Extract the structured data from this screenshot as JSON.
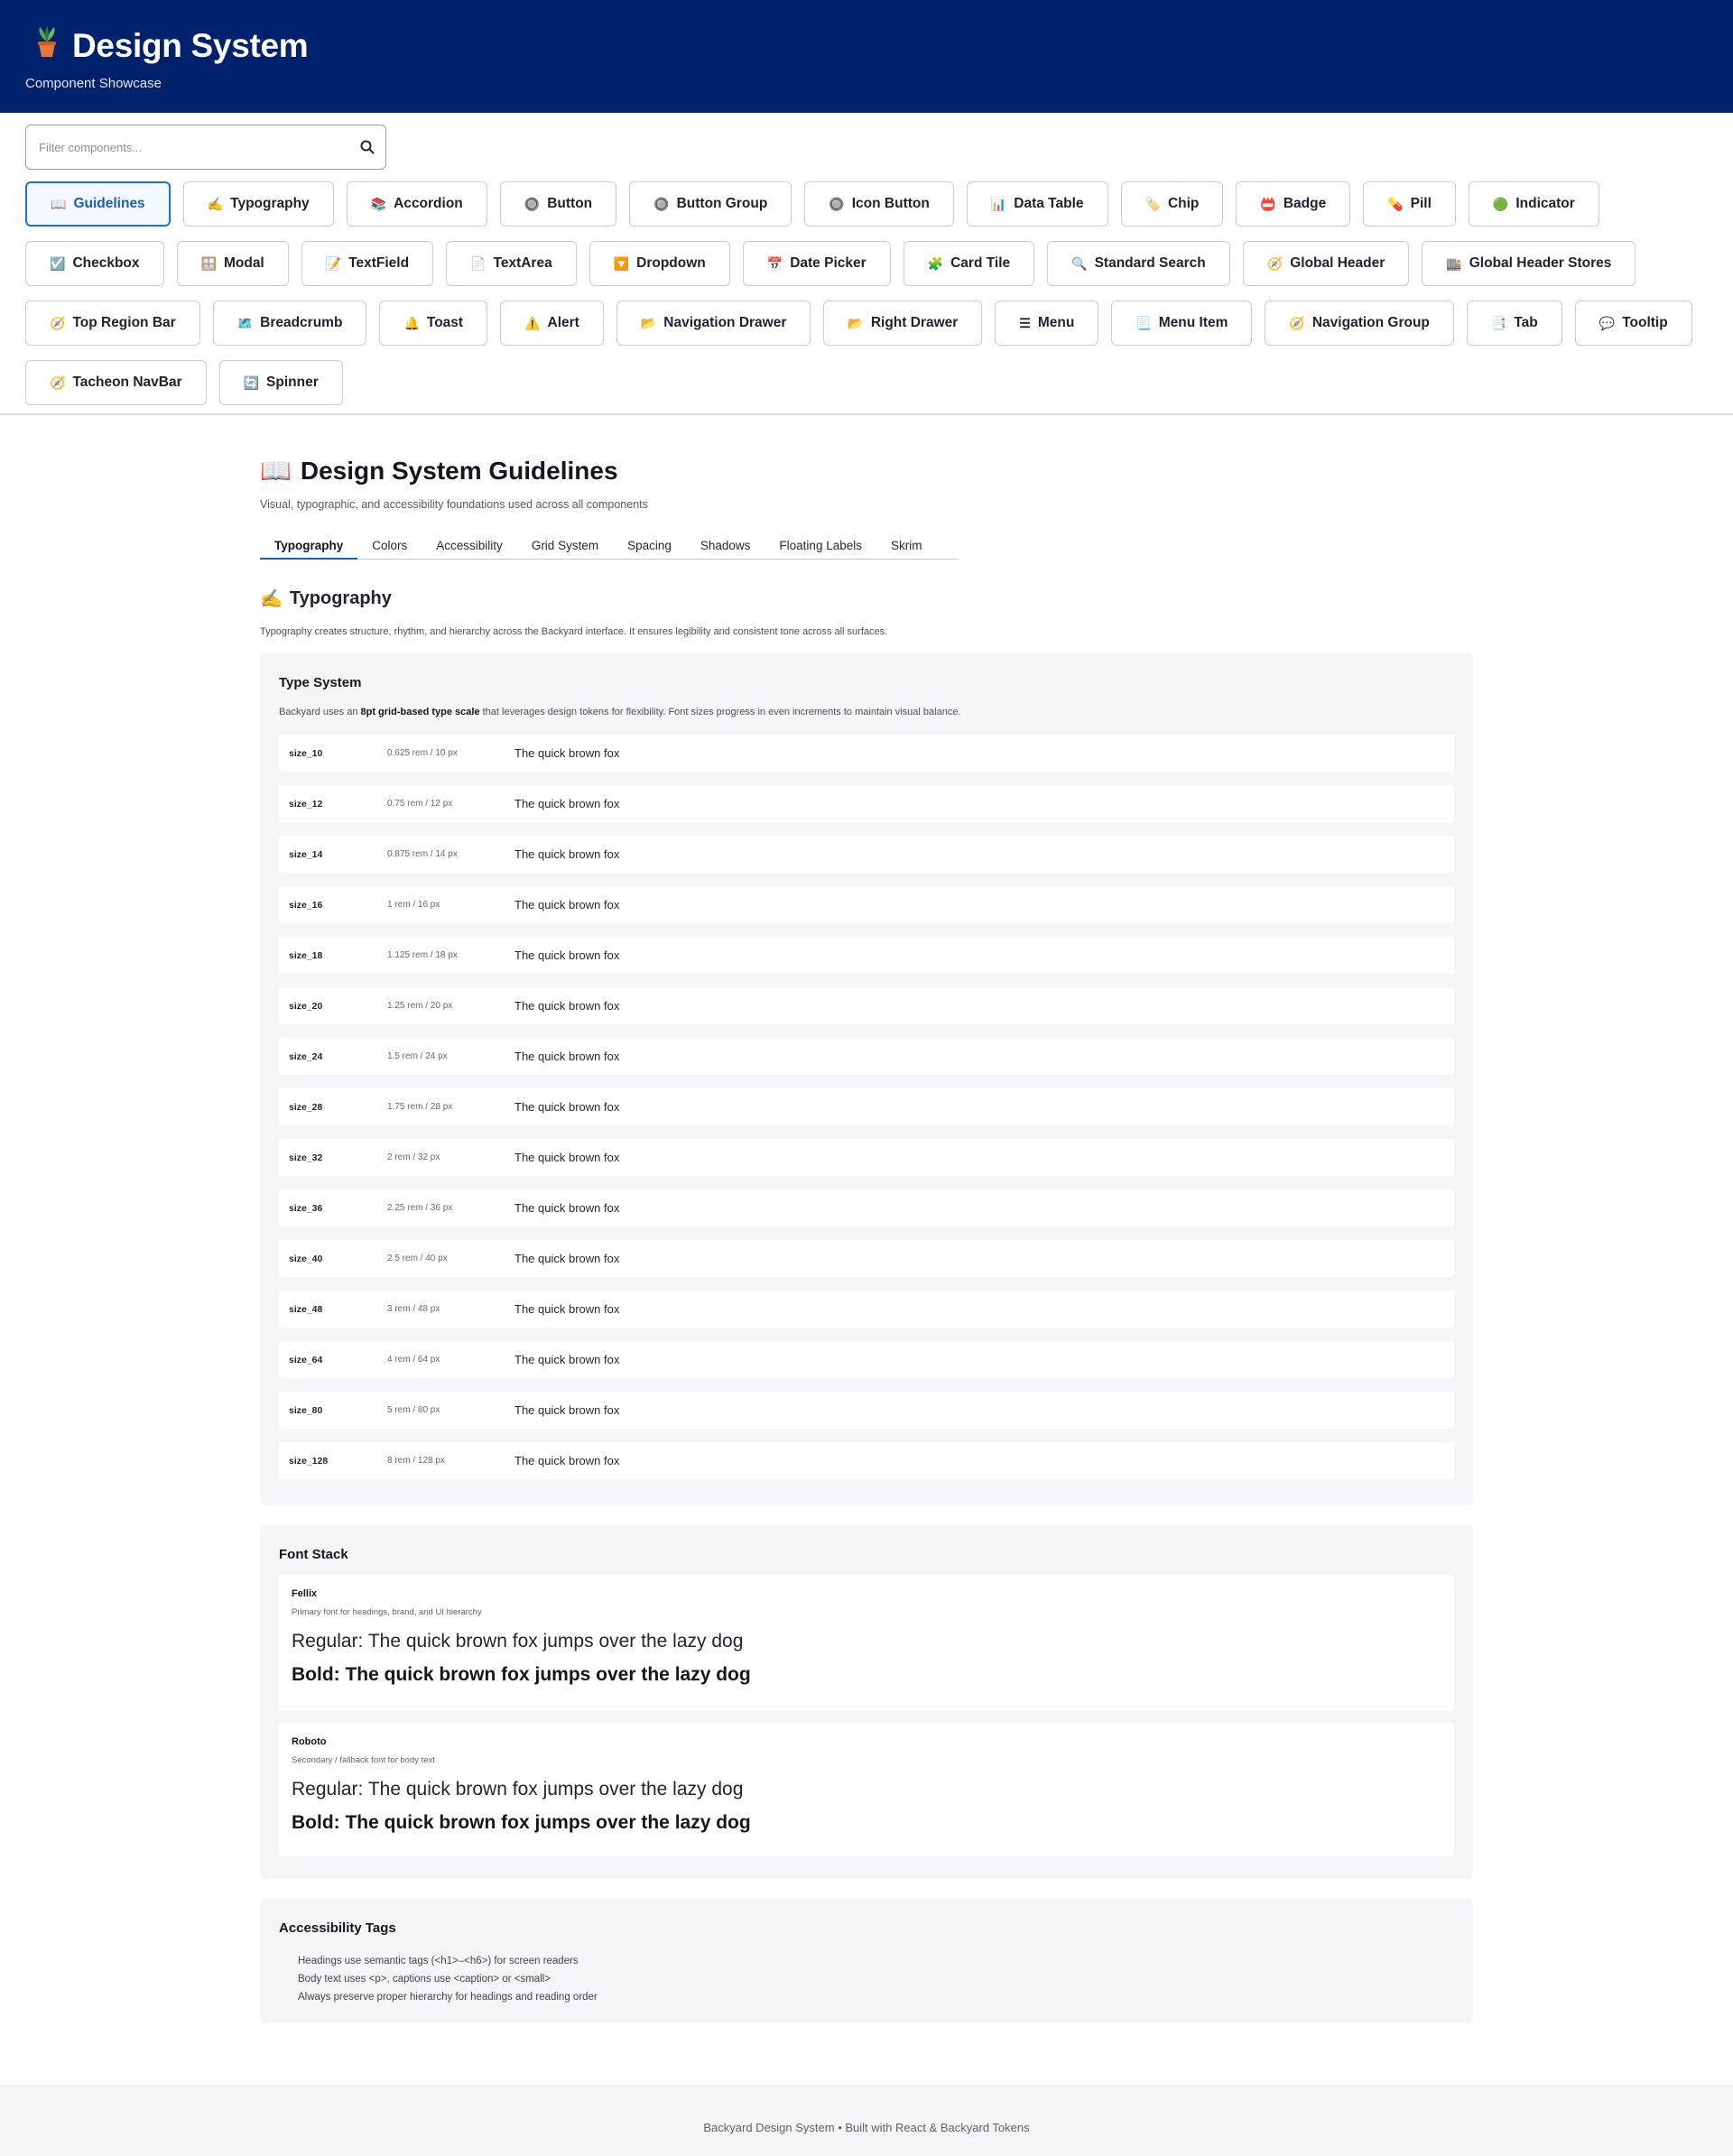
{
  "header": {
    "title": "Design System",
    "subtitle": "Component Showcase"
  },
  "search": {
    "placeholder": "Filter components..."
  },
  "components": [
    {
      "label": "Guidelines",
      "icon": "📖",
      "active": true
    },
    {
      "label": "Typography",
      "icon": "✍️"
    },
    {
      "label": "Accordion",
      "icon": "📚"
    },
    {
      "label": "Button",
      "icon": "🔘"
    },
    {
      "label": "Button Group",
      "icon": "🔘"
    },
    {
      "label": "Icon Button",
      "icon": "🔘"
    },
    {
      "label": "Data Table",
      "icon": "📊"
    },
    {
      "label": "Chip",
      "icon": "🏷️"
    },
    {
      "label": "Badge",
      "icon": "📛"
    },
    {
      "label": "Pill",
      "icon": "💊"
    },
    {
      "label": "Indicator",
      "icon": "🟢"
    },
    {
      "label": "Checkbox",
      "icon": "☑️"
    },
    {
      "label": "Modal",
      "icon": "🪟"
    },
    {
      "label": "TextField",
      "icon": "📝"
    },
    {
      "label": "TextArea",
      "icon": "📄"
    },
    {
      "label": "Dropdown",
      "icon": "🔽"
    },
    {
      "label": "Date Picker",
      "icon": "📅"
    },
    {
      "label": "Card Tile",
      "icon": "🧩"
    },
    {
      "label": "Standard Search",
      "icon": "🔍"
    },
    {
      "label": "Global Header",
      "icon": "🧭"
    },
    {
      "label": "Global Header Stores",
      "icon": "🏬"
    },
    {
      "label": "Top Region Bar",
      "icon": "🧭"
    },
    {
      "label": "Breadcrumb",
      "icon": "🗺️"
    },
    {
      "label": "Toast",
      "icon": "🔔"
    },
    {
      "label": "Alert",
      "icon": "⚠️"
    },
    {
      "label": "Navigation Drawer",
      "icon": "📂"
    },
    {
      "label": "Right Drawer",
      "icon": "📂"
    },
    {
      "label": "Menu",
      "icon": "☰"
    },
    {
      "label": "Menu Item",
      "icon": "📃"
    },
    {
      "label": "Navigation Group",
      "icon": "🧭"
    },
    {
      "label": "Tab",
      "icon": "📑"
    },
    {
      "label": "Tooltip",
      "icon": "💬"
    },
    {
      "label": "Tacheon NavBar",
      "icon": "🧭"
    },
    {
      "label": "Spinner",
      "icon": "🔄"
    }
  ],
  "page": {
    "icon": "📖",
    "title": "Design System Guidelines",
    "subtitle": "Visual, typographic, and accessibility foundations used across all components"
  },
  "tabs": [
    {
      "label": "Typography",
      "active": true
    },
    {
      "label": "Colors"
    },
    {
      "label": "Accessibility"
    },
    {
      "label": "Grid System"
    },
    {
      "label": "Spacing"
    },
    {
      "label": "Shadows"
    },
    {
      "label": "Floating Labels"
    },
    {
      "label": "Skrim"
    }
  ],
  "section": {
    "icon": "✍️",
    "title": "Typography",
    "description": "Typography creates structure, rhythm, and hierarchy across the Backyard interface. It ensures legibility and consistent tone across all surfaces."
  },
  "type_system": {
    "title": "Type System",
    "desc_prefix": "Backyard uses an ",
    "desc_bold": "8pt grid-based type scale",
    "desc_suffix": " that leverages design tokens for flexibility. Font sizes progress in even increments to maintain visual balance.",
    "sample": "The quick brown fox",
    "sizes": [
      {
        "name": "size_10",
        "value": "0.625 rem / 10 px"
      },
      {
        "name": "size_12",
        "value": "0.75 rem / 12 px"
      },
      {
        "name": "size_14",
        "value": "0.875 rem / 14 px"
      },
      {
        "name": "size_16",
        "value": "1 rem / 16 px"
      },
      {
        "name": "size_18",
        "value": "1.125 rem / 18 px"
      },
      {
        "name": "size_20",
        "value": "1.25 rem / 20 px"
      },
      {
        "name": "size_24",
        "value": "1.5 rem / 24 px"
      },
      {
        "name": "size_28",
        "value": "1.75 rem / 28 px"
      },
      {
        "name": "size_32",
        "value": "2 rem / 32 px"
      },
      {
        "name": "size_36",
        "value": "2.25 rem / 36 px"
      },
      {
        "name": "size_40",
        "value": "2.5 rem / 40 px"
      },
      {
        "name": "size_48",
        "value": "3 rem / 48 px"
      },
      {
        "name": "size_64",
        "value": "4 rem / 64 px"
      },
      {
        "name": "size_80",
        "value": "5 rem / 80 px"
      },
      {
        "name": "size_128",
        "value": "8 rem / 128 px"
      }
    ]
  },
  "font_stack": {
    "title": "Font Stack",
    "fonts": [
      {
        "name": "Fellix",
        "description": "Primary font for headings, brand, and UI hierarchy",
        "regular": "Regular: The quick brown fox jumps over the lazy dog",
        "bold": "Bold: The quick brown fox jumps over the lazy dog"
      },
      {
        "name": "Roboto",
        "description": "Secondary / fallback font for body text",
        "regular": "Regular: The quick brown fox jumps over the lazy dog",
        "bold": "Bold: The quick brown fox jumps over the lazy dog"
      }
    ]
  },
  "a11y": {
    "title": "Accessibility Tags",
    "items": [
      "Headings use semantic tags (<h1>–<h6>) for screen readers",
      "Body text uses <p>, captions use <caption> or <small>",
      "Always preserve proper hierarchy for headings and reading order"
    ]
  },
  "footer": {
    "text": "Backyard Design System • Built with React & Backyard Tokens"
  },
  "colors": {
    "header_bg": "#00216b",
    "accent": "#1a73d9",
    "card_bg": "#f4f5f8"
  }
}
